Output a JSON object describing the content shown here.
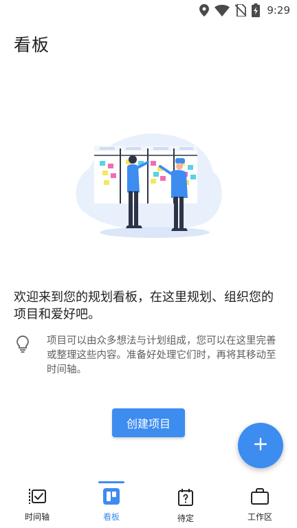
{
  "status_bar": {
    "time": "9:29",
    "icons": [
      "location-icon",
      "wifi-icon",
      "no-sim-icon",
      "battery-charging-icon"
    ]
  },
  "page": {
    "title": "看板"
  },
  "welcome": {
    "text": "欢迎来到您的规划看板，在这里规划、组织您的项目和爱好吧。"
  },
  "tip": {
    "icon": "lightbulb-icon",
    "text": "项目可以由众多想法与计划组成，您可以在这里完善或整理这些内容。准备好处理它们时，再将其移动至时间轴。"
  },
  "actions": {
    "create_project_label": "创建项目",
    "fab_icon": "plus-icon"
  },
  "bottom_nav": {
    "items": [
      {
        "label": "时间轴",
        "icon": "timeline-icon",
        "active": false
      },
      {
        "label": "看板",
        "icon": "board-icon",
        "active": true
      },
      {
        "label": "待定",
        "icon": "pending-icon",
        "active": false
      },
      {
        "label": "工作区",
        "icon": "briefcase-icon",
        "active": false
      }
    ]
  },
  "colors": {
    "accent": "#3d8cf0",
    "text_primary": "#1e1e1e",
    "text_secondary": "#5f5f5f"
  }
}
